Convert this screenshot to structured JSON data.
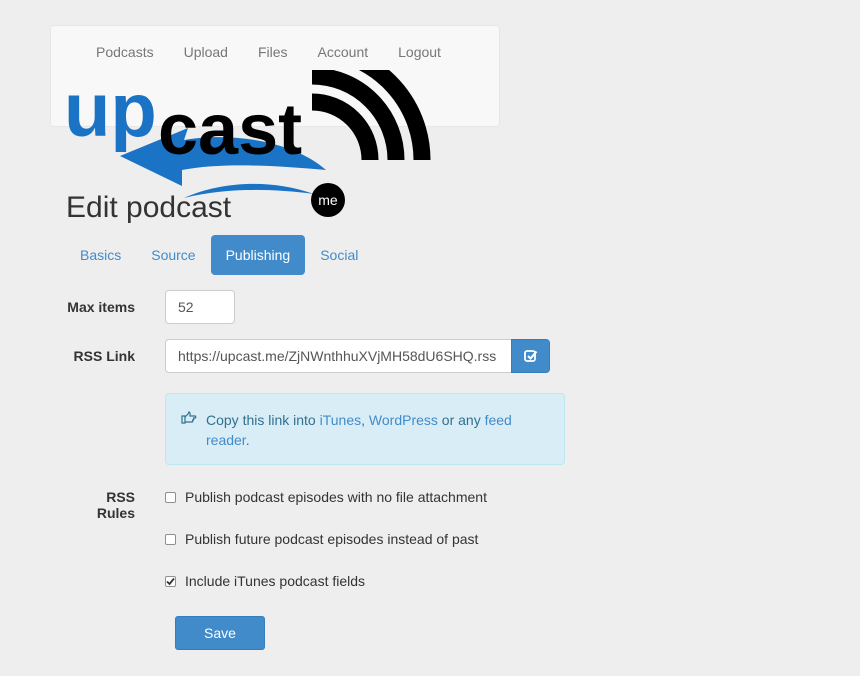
{
  "nav": {
    "items": [
      {
        "label": "Podcasts"
      },
      {
        "label": "Upload"
      },
      {
        "label": "Files"
      },
      {
        "label": "Account"
      },
      {
        "label": "Logout"
      }
    ]
  },
  "logo": {
    "brand_text_blue": "up",
    "brand_text_black": "cast",
    "badge_text": "me"
  },
  "page": {
    "title": "Edit podcast"
  },
  "tabs": [
    {
      "label": "Basics",
      "active": false
    },
    {
      "label": "Source",
      "active": false
    },
    {
      "label": "Publishing",
      "active": true
    },
    {
      "label": "Social",
      "active": false
    }
  ],
  "form": {
    "max_items": {
      "label": "Max items",
      "value": "52"
    },
    "rss_link": {
      "label": "RSS Link",
      "value": "https://upcast.me/ZjNWnthhuXVjMH58dU6SHQ.rss",
      "copy_icon": "check-square-icon"
    },
    "info": {
      "icon": "hand-pointing-icon",
      "prefix": "Copy this link into ",
      "link1": "iTunes",
      "sep1": ", ",
      "link2": "WordPress",
      "sep2": " or any ",
      "link3": "feed reader",
      "suffix": "."
    },
    "rss_rules": {
      "label": "RSS Rules",
      "options": [
        {
          "label": "Publish podcast episodes with no file attachment",
          "checked": false
        },
        {
          "label": "Publish future podcast episodes instead of past",
          "checked": false
        },
        {
          "label": "Include iTunes podcast fields",
          "checked": true
        }
      ]
    },
    "save_label": "Save"
  },
  "colors": {
    "primary": "#428bca",
    "info_bg": "#d9edf7",
    "info_text": "#31708f",
    "page_bg": "#eeeeee",
    "logo_blue": "#1a73c4"
  }
}
